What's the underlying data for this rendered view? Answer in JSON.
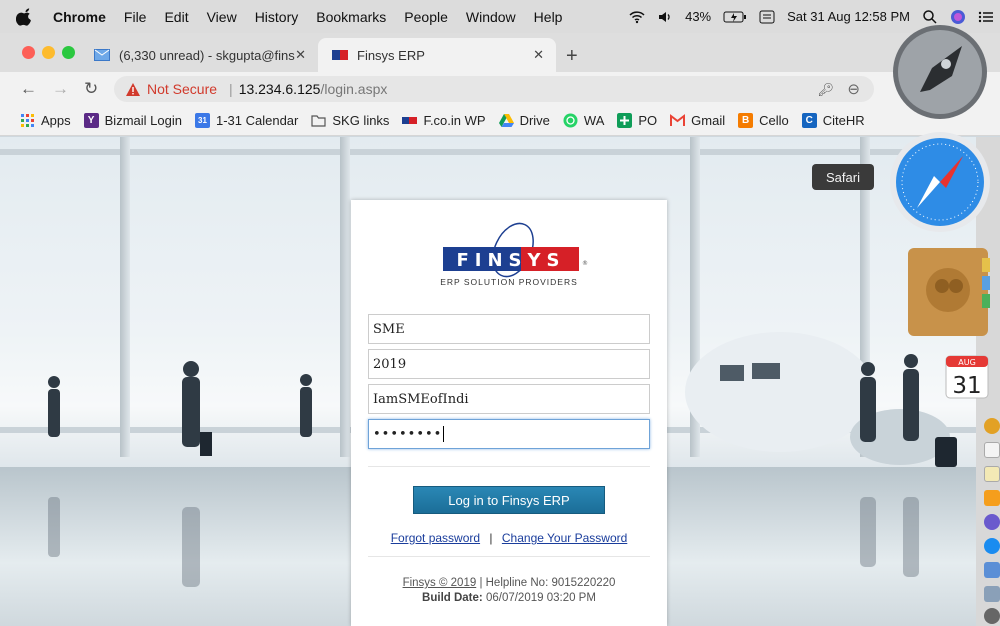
{
  "menubar": {
    "app": "Chrome",
    "items": [
      "File",
      "Edit",
      "View",
      "History",
      "Bookmarks",
      "People",
      "Window",
      "Help"
    ],
    "battery": "43%",
    "datetime": "Sat 31 Aug  12:58 PM"
  },
  "tabs": {
    "inactive_title": "(6,330 unread) - skgupta@fins",
    "active_title": "Finsys ERP"
  },
  "address": {
    "security": "Not Secure",
    "host": "13.234.6.125",
    "path": "/login.aspx"
  },
  "bookmarks": [
    {
      "label": "Apps",
      "color": "#4285f4"
    },
    {
      "label": "Bizmail Login",
      "color": "#5b2a86"
    },
    {
      "label": "1-31 Calendar",
      "color": "#3b78e7"
    },
    {
      "label": "SKG links",
      "color": "#888888"
    },
    {
      "label": "F.co.in WP",
      "color": "#d33"
    },
    {
      "label": "Drive",
      "color": "#fbbc04"
    },
    {
      "label": "WA",
      "color": "#25d366"
    },
    {
      "label": "PO",
      "color": "#0f9d58"
    },
    {
      "label": "Gmail",
      "color": "#ea4335"
    },
    {
      "label": "Cello",
      "color": "#f57c00"
    },
    {
      "label": "CiteHR",
      "color": "#1565c0"
    }
  ],
  "dock": {
    "tooltip": "Safari",
    "calendar_month": "AUG",
    "calendar_day": "31"
  },
  "login": {
    "logo_text": "FINSYS",
    "logo_mark": "®",
    "tagline": "ERP SOLUTION PROVIDERS",
    "company": "SME",
    "year": "2019",
    "username": "IamSMEofIndi",
    "password_mask": "••••••••",
    "button_label": "Log in to Finsys ERP",
    "forgot_label": "Forgot password",
    "link_separator": "|",
    "change_label": "Change Your Password",
    "copyright": "Finsys © 2019",
    "helpline": "| Helpline No: 9015220220",
    "build_label": "Build Date:",
    "build_value": "06/07/2019 03:20 PM"
  },
  "colors": {
    "accent": "#1f78a8",
    "not_secure": "#d13a2c",
    "link": "#1a3d9c",
    "logo_red": "#d62027",
    "logo_blue": "#1d3f91"
  }
}
